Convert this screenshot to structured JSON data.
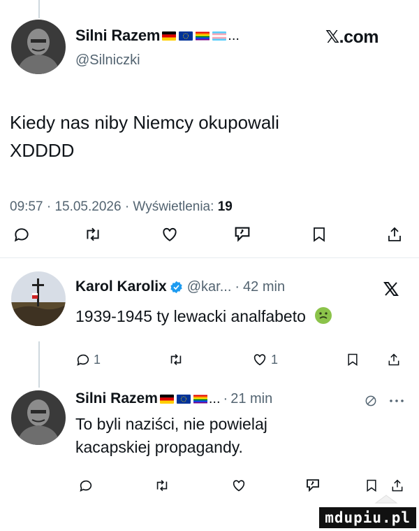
{
  "main_tweet": {
    "display_name": "Silni Razem",
    "name_suffix": "...",
    "handle": "@Silniczki",
    "brand": "𝕏.com",
    "text_line1": "Kiedy nas niby Niemcy okupowali",
    "text_line2": "XDDDD",
    "time": "09:57",
    "date": "15.05.2026",
    "views_label": "Wyświetlenia:",
    "views_count": "19"
  },
  "reply1": {
    "display_name": "Karol Karolix",
    "handle": "@kar...",
    "age": "42 min",
    "text": "1939-1945 ty lewacki analfabeto",
    "reply_count": "1",
    "like_count": "1"
  },
  "reply2": {
    "display_name": "Silni Razem",
    "name_suffix": "...",
    "age": "21 min",
    "text_line1": "To byli naziści, nie powielaj",
    "text_line2": "kacapskiej propagandy."
  },
  "separator": "·",
  "watermark": "mdupiu.pl",
  "colors": {
    "text": "#0f1419",
    "muted": "#536471",
    "divider": "#e6ecf0",
    "verified": "#1d9bf0"
  }
}
